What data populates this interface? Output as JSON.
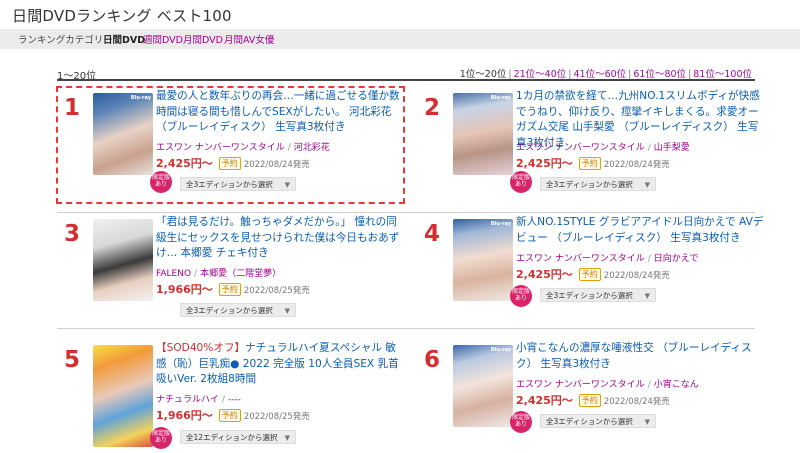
{
  "page_title": "日間DVDランキング ベスト100",
  "categories": {
    "label": "ランキングカテゴリー",
    "active": "日間DVD",
    "links": [
      "週間DVD",
      "月間DVD",
      "月間AV女優"
    ]
  },
  "range_label": "1〜20位",
  "pagination": {
    "current": "1位〜20位",
    "links": [
      "21位〜40位",
      "41位〜60位",
      "61位〜80位",
      "81位〜100位"
    ]
  },
  "reservation_label": "予約",
  "limited_badge": "限定版あり",
  "items": [
    {
      "rank": "1",
      "title": "最愛の人と数年ぶりの再会…一緒に過ごせる僅か数時間は寝る間も惜しんでSEXがしたい。 河北彩花 （ブルーレイディスク） 生写真3枚付き",
      "maker": "エスワン ナンバーワンスタイル",
      "actress": "河北彩花",
      "price": "2,425円〜",
      "release": "2022/08/24発売",
      "select": "全3エディションから選択"
    },
    {
      "rank": "2",
      "title": "1カ月の禁欲を経て…九州NO.1スリムボディが快感でうねり、仰け反り、痙攣イキしまくる。求愛オーガズム交尾 山手梨愛 （ブルーレイディスク） 生写真3枚付き",
      "maker": "エスワン ナンバーワンスタイル",
      "actress": "山手梨愛",
      "price": "2,425円〜",
      "release": "2022/08/24発売",
      "select": "全3エディションから選択"
    },
    {
      "rank": "3",
      "title": "「君は見るだけ。触っちゃダメだから。」 憧れの同級生にセックスを見せつけられた僕は今日もおあずけ… 本郷愛 チェキ付き",
      "maker": "FALENO",
      "actress": "本郷愛（二階堂夢）",
      "price": "1,966円〜",
      "release": "2022/08/25発売",
      "select": "全3エディションから選択"
    },
    {
      "rank": "4",
      "title": "新人NO.1STYLE グラビアアイドル日向かえで AVデビュー （ブルーレイディスク） 生写真3枚付き",
      "maker": "エスワン ナンバーワンスタイル",
      "actress": "日向かえで",
      "price": "2,425円〜",
      "release": "2022/08/24発売",
      "select": "全3エディションから選択"
    },
    {
      "rank": "5",
      "title_prefix": "【SOD40%オフ】",
      "title": "ナチュラルハイ夏スペシャル 敏感（恥）巨乳痴● 2022 完全版 10人全員SEX 乳首吸いVer. 2枚組8時間",
      "maker": "ナチュラルハイ",
      "actress": "----",
      "price": "1,966円〜",
      "release": "2022/08/25発売",
      "select": "全12エディションから選択"
    },
    {
      "rank": "6",
      "title": "小宵こなんの濃厚な唾液性交 （ブルーレイディスク） 生写真3枚付き",
      "maker": "エスワン ナンバーワンスタイル",
      "actress": "小宵こなん",
      "price": "2,425円〜",
      "release": "2022/08/24発売",
      "select": "全3エディションから選択"
    }
  ],
  "colors": {
    "accent": "#d32f2f",
    "link": "#0a5db3",
    "maker": "#a3008f",
    "badge": "#d8256a"
  }
}
